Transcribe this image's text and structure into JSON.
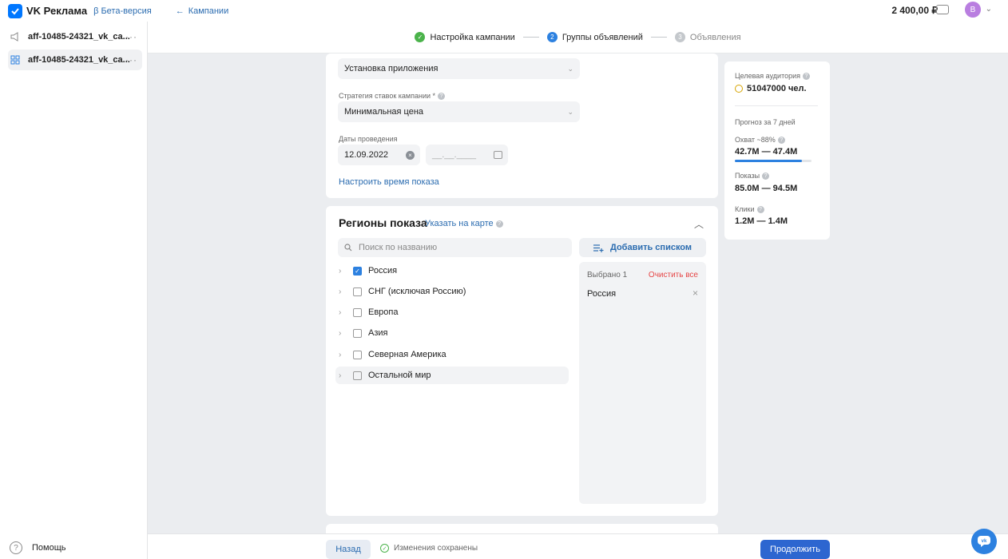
{
  "topbar": {
    "brand": "VK Реклама",
    "beta": "β Бета-версия",
    "back": "Кампании",
    "balance": "2 400,00 ₽",
    "avatar": "В"
  },
  "sidebar": {
    "items": [
      {
        "label": "aff-10485-24321_vk_ca..."
      },
      {
        "label": "aff-10485-24321_vk_ca..."
      }
    ],
    "help": "Помощь"
  },
  "steps": [
    {
      "label": "Настройка кампании",
      "mark": "✓"
    },
    {
      "label": "Группы объявлений",
      "mark": "2"
    },
    {
      "label": "Объявления",
      "mark": "3"
    }
  ],
  "settings": {
    "objective_value": "Установка приложения",
    "strategy_label": "Стратегия ставок кампании *",
    "strategy_value": "Минимальная цена",
    "dates_label": "Даты проведения",
    "date_start": "12.09.2022",
    "date_end_placeholder": "__.__.____",
    "time_link": "Настроить время показа"
  },
  "regions": {
    "title": "Регионы показа",
    "map_link": "Указать на карте",
    "search_placeholder": "Поиск по названию",
    "add_list": "Добавить списком",
    "items": [
      {
        "label": "Россия",
        "checked": true
      },
      {
        "label": "СНГ (исключая Россию)",
        "checked": false
      },
      {
        "label": "Европа",
        "checked": false
      },
      {
        "label": "Азия",
        "checked": false
      },
      {
        "label": "Северная Америка",
        "checked": false
      },
      {
        "label": "Остальной мир",
        "checked": false
      }
    ],
    "selected_count": "Выбрано 1",
    "clear_all": "Очистить все",
    "selected_items": [
      "Россия"
    ]
  },
  "stats": {
    "audience_label": "Целевая аудитория",
    "audience_value": "51047000 чел.",
    "forecast_label": "Прогноз за 7 дней",
    "reach_label": "Охват ~88%",
    "reach_value": "42.7M — 47.4M",
    "reach_fill": 0.88,
    "impressions_label": "Показы",
    "impressions_value": "85.0M — 94.5M",
    "clicks_label": "Клики",
    "clicks_value": "1.2M — 1.4M"
  },
  "bottom": {
    "back": "Назад",
    "saved": "Изменения сохранены",
    "next": "Продолжить"
  },
  "colors": {
    "accent": "#2d81e0",
    "primary_button": "#2d66d0",
    "success": "#4bb34b",
    "danger": "#e64646"
  }
}
